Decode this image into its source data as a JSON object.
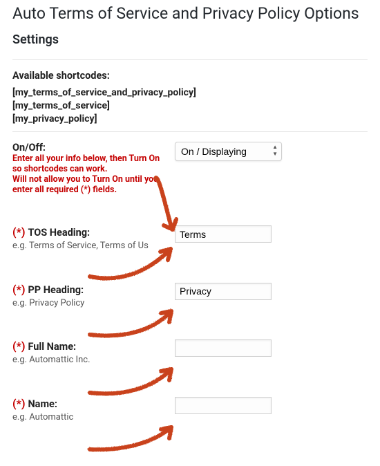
{
  "page": {
    "title": "Auto Terms of Service and Privacy Policy Options",
    "subtitle": "Settings"
  },
  "shortcodes": {
    "heading": "Available shortcodes:",
    "list": [
      "[my_terms_of_service_and_privacy_policy]",
      "[my_terms_of_service]",
      "[my_privacy_policy]"
    ]
  },
  "fields": {
    "onoff": {
      "label": "On/Off:",
      "note1": "Enter all your info below, then Turn On so shortcodes can work.",
      "note2": "Will not allow you to Turn On until you enter all required (*) fields.",
      "value": "On / Displaying"
    },
    "tos_heading": {
      "req": "(*) ",
      "label": "TOS Heading:",
      "hint": "e.g. Terms of Service, Terms of Us",
      "value": "Terms"
    },
    "pp_heading": {
      "req": "(*) ",
      "label": "PP Heading:",
      "hint": "e.g. Privacy Policy",
      "value": "Privacy"
    },
    "full_name": {
      "req": "(*) ",
      "label": "Full Name:",
      "hint": "e.g. Automattic Inc.",
      "value": ""
    },
    "name": {
      "req": "(*) ",
      "label": "Name:",
      "hint": "e.g. Automattic",
      "value": ""
    }
  }
}
